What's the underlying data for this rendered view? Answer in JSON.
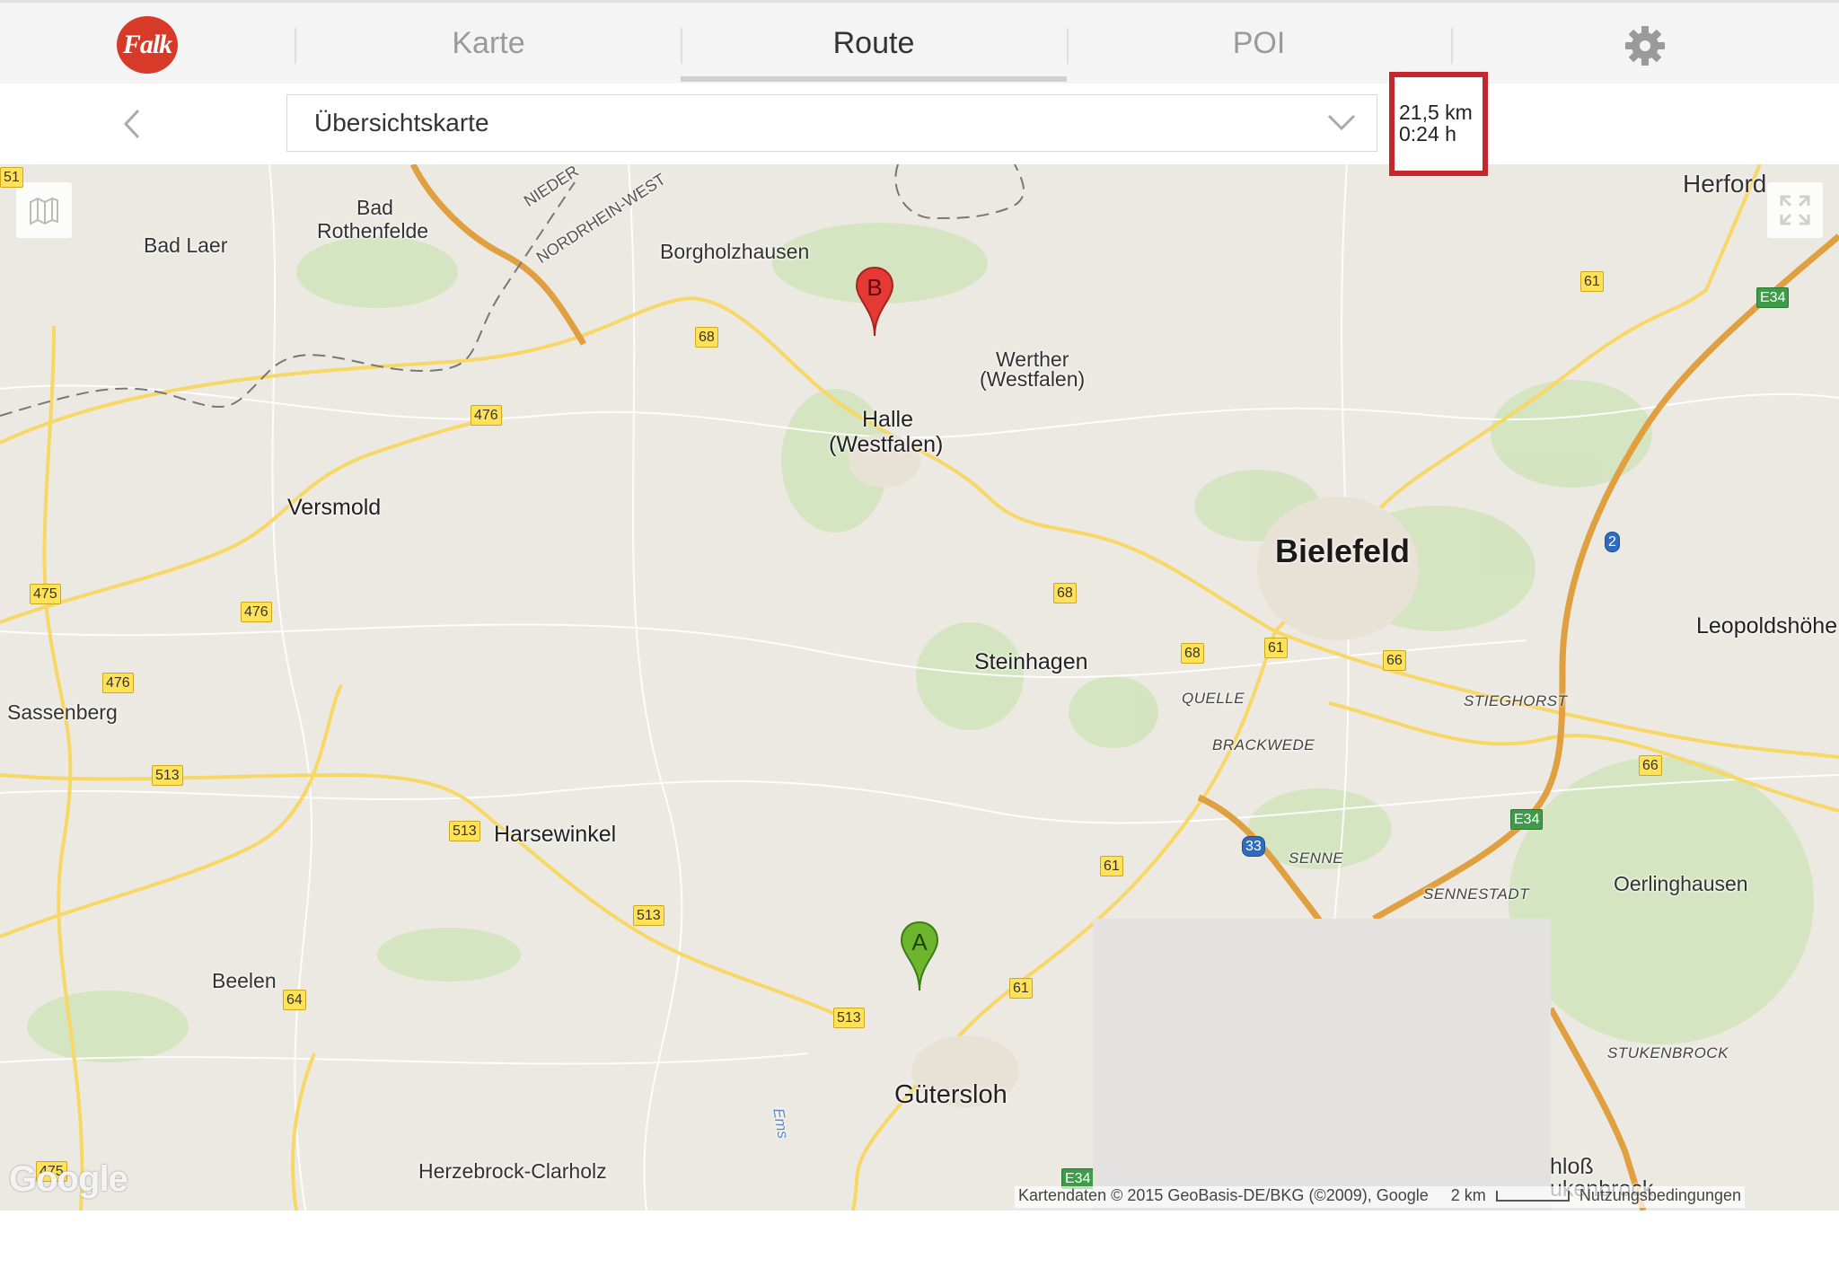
{
  "app": {
    "logo_text": "Falk"
  },
  "tabs": [
    {
      "label": "Karte",
      "active": false
    },
    {
      "label": "Route",
      "active": true
    },
    {
      "label": "POI",
      "active": false
    }
  ],
  "toolbar": {
    "select_value": "Übersichtskarte",
    "route_distance": "21,5 km",
    "route_time": "0:24 h"
  },
  "markers": {
    "start": "A",
    "end": "B"
  },
  "map": {
    "places": [
      {
        "name": "Bielefeld",
        "kind": "big"
      },
      {
        "name": "Gütersloh",
        "kind": "city"
      },
      {
        "name": "Herford",
        "kind": "city"
      },
      {
        "name": "Bad",
        "kind": "town"
      },
      {
        "name": "Rothenfelde",
        "kind": "town"
      },
      {
        "name": "Bad Laer",
        "kind": "town"
      },
      {
        "name": "Borgholzhausen",
        "kind": "town"
      },
      {
        "name": "Werther",
        "kind": "town"
      },
      {
        "name": "(Westfalen)",
        "kind": "town"
      },
      {
        "name": "Halle",
        "kind": "city"
      },
      {
        "name": "(Westfalen)",
        "kind": "city"
      },
      {
        "name": "Versmold",
        "kind": "city"
      },
      {
        "name": "Steinhagen",
        "kind": "city"
      },
      {
        "name": "Leopoldshöhe",
        "kind": "city"
      },
      {
        "name": "Sassenberg",
        "kind": "town"
      },
      {
        "name": "Harsewinkel",
        "kind": "city"
      },
      {
        "name": "Oerlinghausen",
        "kind": "town"
      },
      {
        "name": "Beelen",
        "kind": "town"
      },
      {
        "name": "Herzebrock-Clarholz",
        "kind": "town"
      },
      {
        "name": "hloß",
        "kind": "town"
      },
      {
        "name": "ukenbrock",
        "kind": "town"
      },
      {
        "name": "Ems",
        "kind": "water"
      }
    ],
    "districts": [
      "QUELLE",
      "BRACKWEDE",
      "STIEGHORST",
      "SENNE",
      "SENNESTADT",
      "STUKENBROCK"
    ],
    "border_labels": [
      "NIEDER",
      "NORDRHEIN-WEST"
    ],
    "roads": [
      "51",
      "68",
      "476",
      "476",
      "475",
      "476",
      "476",
      "513",
      "513",
      "513",
      "513",
      "64",
      "475",
      "68",
      "68",
      "61",
      "66",
      "61",
      "61",
      "61",
      "66",
      "E34",
      "E34",
      "E34",
      "2",
      "33"
    ],
    "attribution": "Kartendaten © 2015 GeoBasis-DE/BKG (©2009), Google",
    "scale": "2 km",
    "terms": "Nutzungsbedingungen",
    "google": "Google"
  },
  "colors": {
    "accent": "#c1272d",
    "logo": "#d83a2a",
    "marker_start": "#6cb52d",
    "marker_end": "#e53935",
    "motorway": "#e0a040"
  },
  "icons": {
    "settings": "gear-icon",
    "back": "chevron-left-icon",
    "dropdown": "chevron-down-icon",
    "map_layers": "map-icon",
    "fullscreen": "fullscreen-icon"
  }
}
